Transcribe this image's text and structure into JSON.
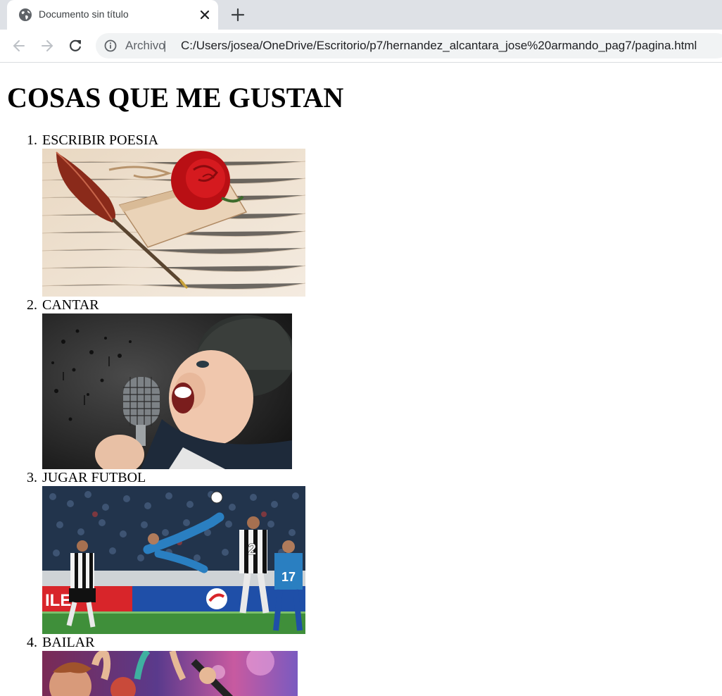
{
  "browser": {
    "tab_title": "Documento sin título",
    "omnibox_chip": "Archivo",
    "omnibox_separator": "|",
    "url": "C:/Users/josea/OneDrive/Escritorio/p7/hernandez_alcantara_jose%20armando_pag7/pagina.html"
  },
  "page": {
    "heading": "COSAS QUE ME GUSTAN",
    "items": [
      {
        "number": "1.",
        "label": "ESCRIBIR POESIA"
      },
      {
        "number": "2.",
        "label": "CANTAR"
      },
      {
        "number": "3.",
        "label": "JUGAR FUTBOL",
        "banner_text": "ILE",
        "jersey_numbers": [
          "2",
          "17"
        ]
      },
      {
        "number": "4.",
        "label": "BAILAR"
      }
    ]
  }
}
